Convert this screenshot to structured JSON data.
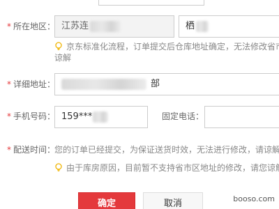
{
  "region": {
    "label": "所在地区：",
    "province_value": "江苏连",
    "city_value": "栖",
    "tip": "京东标准化流程，订单提交后仓库地址确定，无法修改省市",
    "tip_line2": "谅解"
  },
  "address": {
    "label": "详细地址：",
    "value_visible_suffix": "部"
  },
  "phone": {
    "label": "手机号码：",
    "value": "159***",
    "landline_label": "固定电话："
  },
  "delivery": {
    "label": "配送时间：",
    "text": "您的订单已经提交，为保证送货时效，无法进行修改，请谅解",
    "tip": "由于库房原因，目前暂不支持省市区地址的修改，请您谅解"
  },
  "buttons": {
    "confirm": "确定",
    "cancel": "取消"
  },
  "watermark": "booso.com",
  "colors": {
    "required": "#e4393c",
    "primary": "#e4393c",
    "tip_icon": "#f0b400"
  },
  "icons": {
    "tip": "lightbulb-icon"
  }
}
